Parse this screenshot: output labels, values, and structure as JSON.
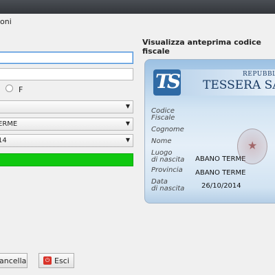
{
  "menubar": {
    "item": "oni"
  },
  "preview": {
    "title": "Visualizza anteprima codice fiscale"
  },
  "form": {
    "radio_f_label": "F",
    "select1_value": "",
    "select2_value": "ERME",
    "select3_value": "14"
  },
  "buttons": {
    "cancella_label": "ancella",
    "esci_label": "Esci"
  },
  "card": {
    "repubblica": "REPUBBLI",
    "title": "TESSERA SANIT",
    "labels": {
      "codice_fiscale": "Codice\nFiscale",
      "cognome": "Cognome",
      "nome": "Nome",
      "luogo_nascita": "Luogo\ndi nascita",
      "provincia": "Provincia",
      "data_nascita": "Data\ndi nascita"
    },
    "values": {
      "luogo_nascita": "ABANO TERME",
      "provincia": "ABANO TERME",
      "data_nascita": "26/10/2014"
    }
  },
  "colors": {
    "green_bar": "#10c810",
    "field_focus": "#4a90d9"
  }
}
